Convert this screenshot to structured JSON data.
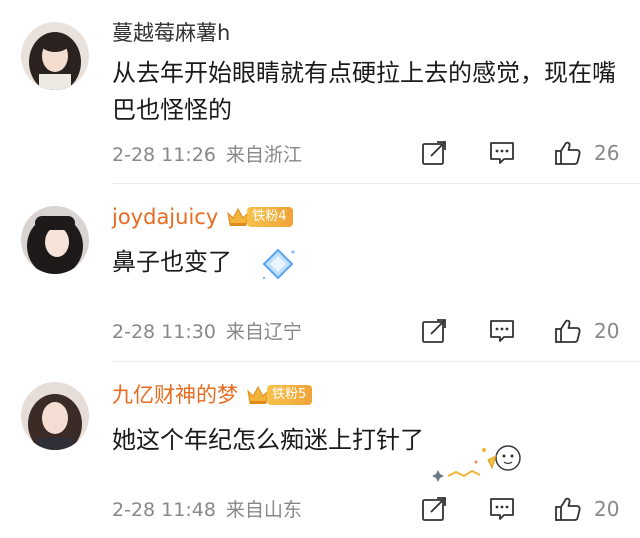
{
  "comments": [
    {
      "username": "蔓越莓麻薯h",
      "text": "从去年开始眼睛就有点硬拉上去的感觉，现在嘴巴也怪怪的",
      "time": "2-28 11:26",
      "location": "来自浙江",
      "likes": "26",
      "vip": false
    },
    {
      "username": "joydajuicy",
      "fan_badge": "铁粉4",
      "text": "鼻子也变了",
      "time": "2-28 11:30",
      "location": "来自辽宁",
      "likes": "20",
      "vip": true
    },
    {
      "username": "九亿财神的梦",
      "fan_badge": "铁粉5",
      "text": "她这个年纪怎么痴迷上打针了",
      "time": "2-28 11:48",
      "location": "来自山东",
      "likes": "20",
      "vip": true
    }
  ],
  "colors": {
    "vip_name": "#e86b1f",
    "meta_gray": "#888888",
    "badge_gold": "#f0a238"
  },
  "icons": [
    "share-icon",
    "comment-icon",
    "thumbs-up-icon",
    "crown-icon"
  ]
}
